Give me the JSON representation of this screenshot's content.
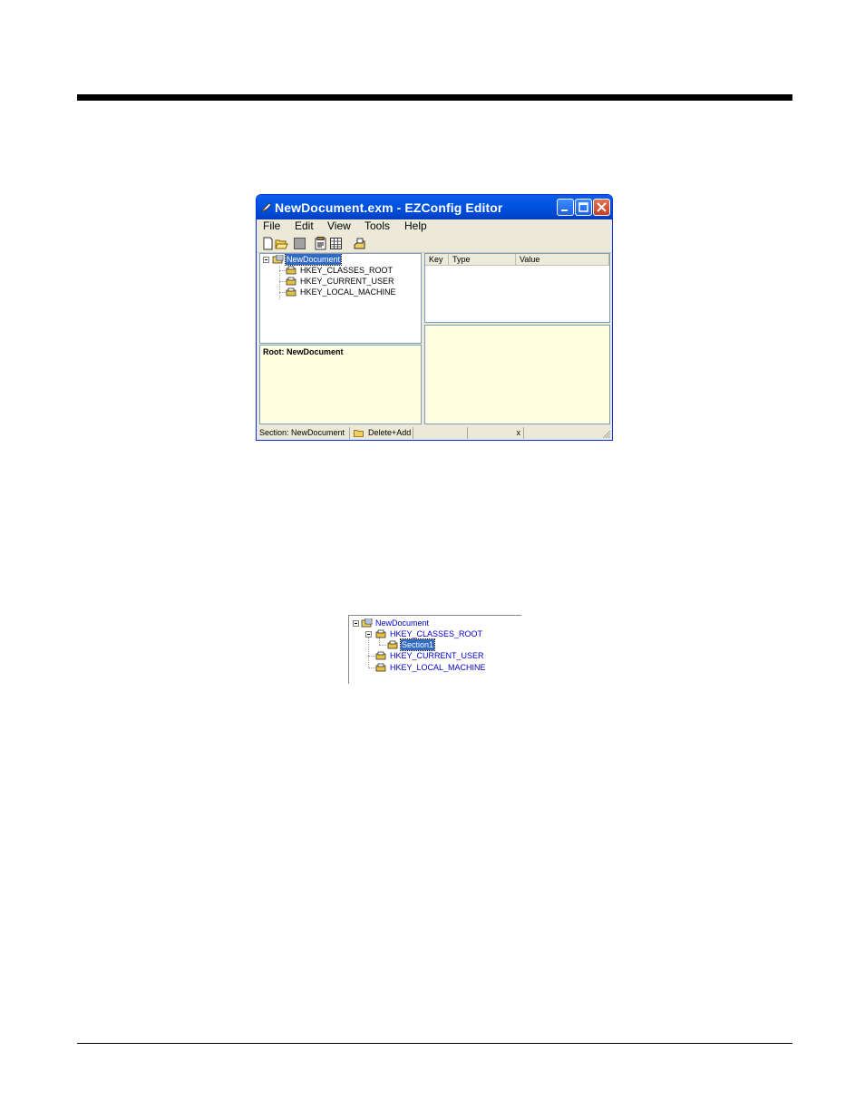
{
  "window": {
    "title": "NewDocument.exm - EZConfig Editor",
    "menu": [
      "File",
      "Edit",
      "View",
      "Tools",
      "Help"
    ],
    "toolbar_icons": [
      "new-icon",
      "open-icon",
      "save-icon",
      "properties-icon",
      "grid-icon",
      "export-icon"
    ],
    "tree": {
      "root": "NewDocument",
      "children": [
        "HKEY_CLASSES_ROOT",
        "HKEY_CURRENT_USER",
        "HKEY_LOCAL_MACHINE"
      ]
    },
    "info": "Root: NewDocument",
    "columns": [
      "Key",
      "Type",
      "Value"
    ],
    "status": {
      "section": "Section: NewDocument",
      "mode": "Delete+Add",
      "marker": "x"
    }
  },
  "tree2": {
    "root": "NewDocument",
    "children": [
      {
        "label": "HKEY_CLASSES_ROOT",
        "children": [
          "Section1"
        ]
      },
      {
        "label": "HKEY_CURRENT_USER"
      },
      {
        "label": "HKEY_LOCAL_MACHINE"
      }
    ]
  },
  "colors": {
    "titlebar": "#0054e3",
    "selection": "#316ac5",
    "info_background": "#ffffe1",
    "window_face": "#ece9d8",
    "tree2_text": "#0000cc"
  }
}
